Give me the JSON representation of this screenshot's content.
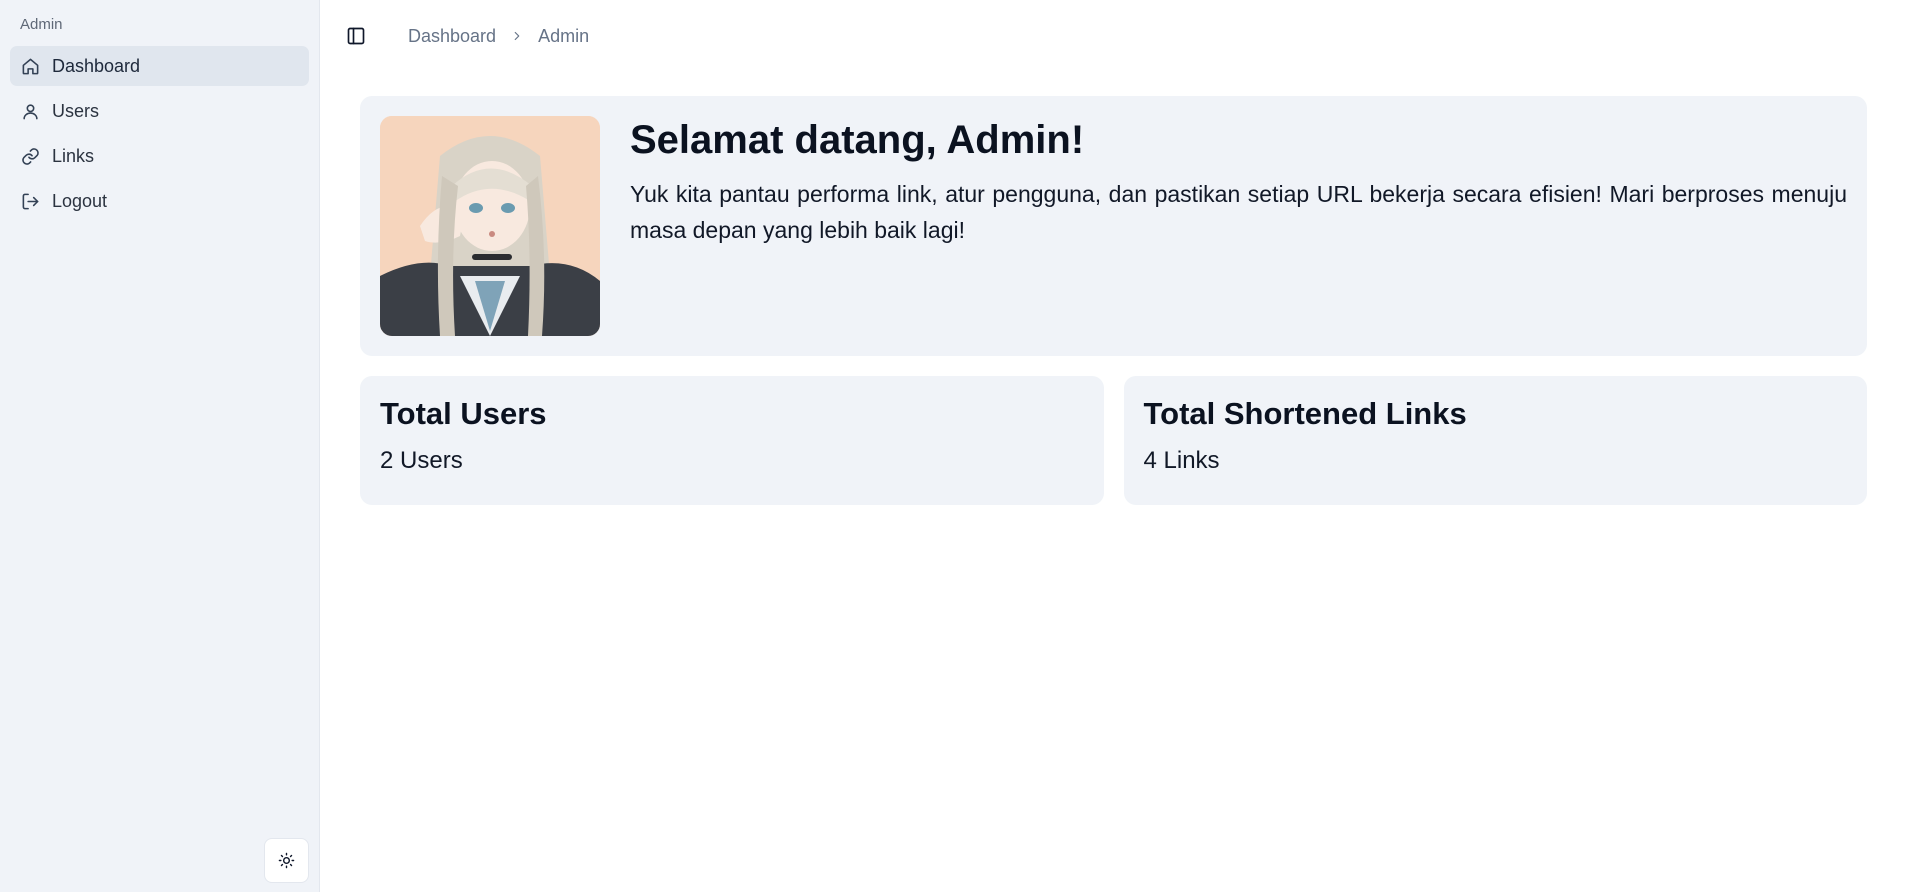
{
  "sidebar": {
    "group_label": "Admin",
    "items": [
      {
        "label": "Dashboard",
        "icon": "home-icon",
        "active": true
      },
      {
        "label": "Users",
        "icon": "user-icon",
        "active": false
      },
      {
        "label": "Links",
        "icon": "link-icon",
        "active": false
      },
      {
        "label": "Logout",
        "icon": "logout-icon",
        "active": false
      }
    ],
    "theme_toggle_icon": "sun-icon"
  },
  "header": {
    "sidebar_toggle_icon": "panel-left-icon",
    "breadcrumb": [
      "Dashboard",
      "Admin"
    ]
  },
  "welcome": {
    "title": "Selamat datang, Admin!",
    "description": "Yuk kita pantau performa link, atur pengguna, dan pastikan setiap URL bekerja secara efisien! Mari berproses menuju masa depan yang lebih baik lagi!"
  },
  "stats": [
    {
      "title": "Total Users",
      "value": "2 Users"
    },
    {
      "title": "Total Shortened Links",
      "value": "4 Links"
    }
  ],
  "colors": {
    "sidebar_bg": "#f0f3f8",
    "card_bg": "#f0f3f8",
    "active_item_bg": "#e0e6ee",
    "breadcrumb_text": "#667387"
  }
}
